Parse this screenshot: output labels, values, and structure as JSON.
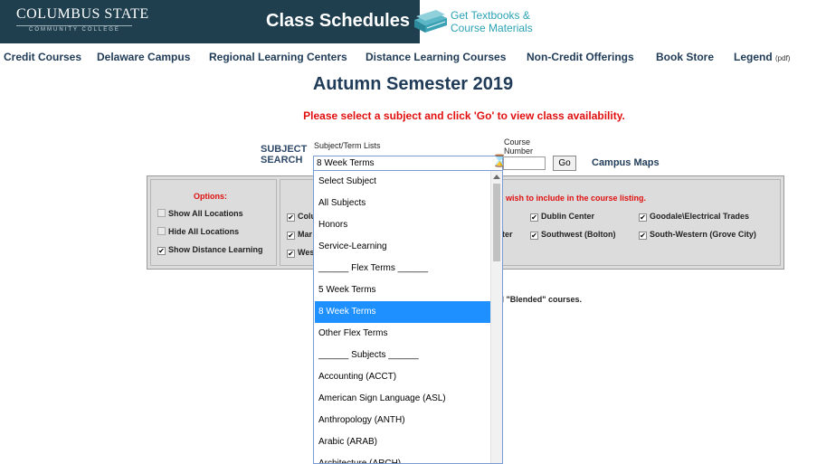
{
  "header": {
    "logo_main": "COLUMBUS STATE",
    "logo_sub": "COMMUNITY COLLEGE",
    "title": "Class Schedules",
    "textbooks_link": [
      "Get Textbooks &",
      "Course Materials"
    ],
    "colors": {
      "dark_bg": "#1f3f4f",
      "accent": "#2ba3b5"
    }
  },
  "nav": {
    "items": [
      "Credit Courses",
      "Delaware Campus",
      "Regional Learning Centers",
      "Distance Learning Courses",
      "Non-Credit Offerings",
      "Book Store",
      "Legend"
    ],
    "legend_suffix": "(pdf)"
  },
  "main": {
    "semester_title": "Autumn Semester 2019",
    "instruction": "Please select a subject and click 'Go' to view class availability.",
    "subject_search_label": [
      "SUBJECT",
      "SEARCH"
    ],
    "term_list_label": "Subject/Term Lists",
    "selected_value": "8 Week Terms",
    "course_number_label": [
      "Course",
      "Number"
    ],
    "go_label": "Go",
    "campus_maps_label": "Campus Maps"
  },
  "options": {
    "title": "Options:",
    "items": [
      {
        "label": "Show All Locations",
        "checked": false,
        "disabled": true
      },
      {
        "label": "Hide All Locations",
        "checked": false,
        "disabled": true
      },
      {
        "label": "Show Distance Learning",
        "checked": true,
        "disabled": false
      }
    ]
  },
  "locations": {
    "note": "u wish to include in the course listing.",
    "items_visible": [
      "Colu",
      "Mar",
      "Wes",
      "ter",
      "Dublin Center",
      "Goodale\\Electrical Trades",
      "Southwest (Bolton)",
      "South-Western (Grove City)"
    ]
  },
  "blended_note": "led \"Blended\" courses.",
  "dropdown": {
    "options": [
      "Select Subject",
      "All Subjects",
      "Honors",
      "Service-Learning",
      "______ Flex Terms ______",
      "5 Week Terms",
      "8 Week Terms",
      "Other Flex Terms",
      "______ Subjects ______",
      "Accounting (ACCT)",
      "American Sign Language (ASL)",
      "Anthropology (ANTH)",
      "Arabic (ARAB)",
      "Architecture (ARCH)"
    ],
    "selected_index": 6,
    "highlight_color": "#1e90ff"
  }
}
